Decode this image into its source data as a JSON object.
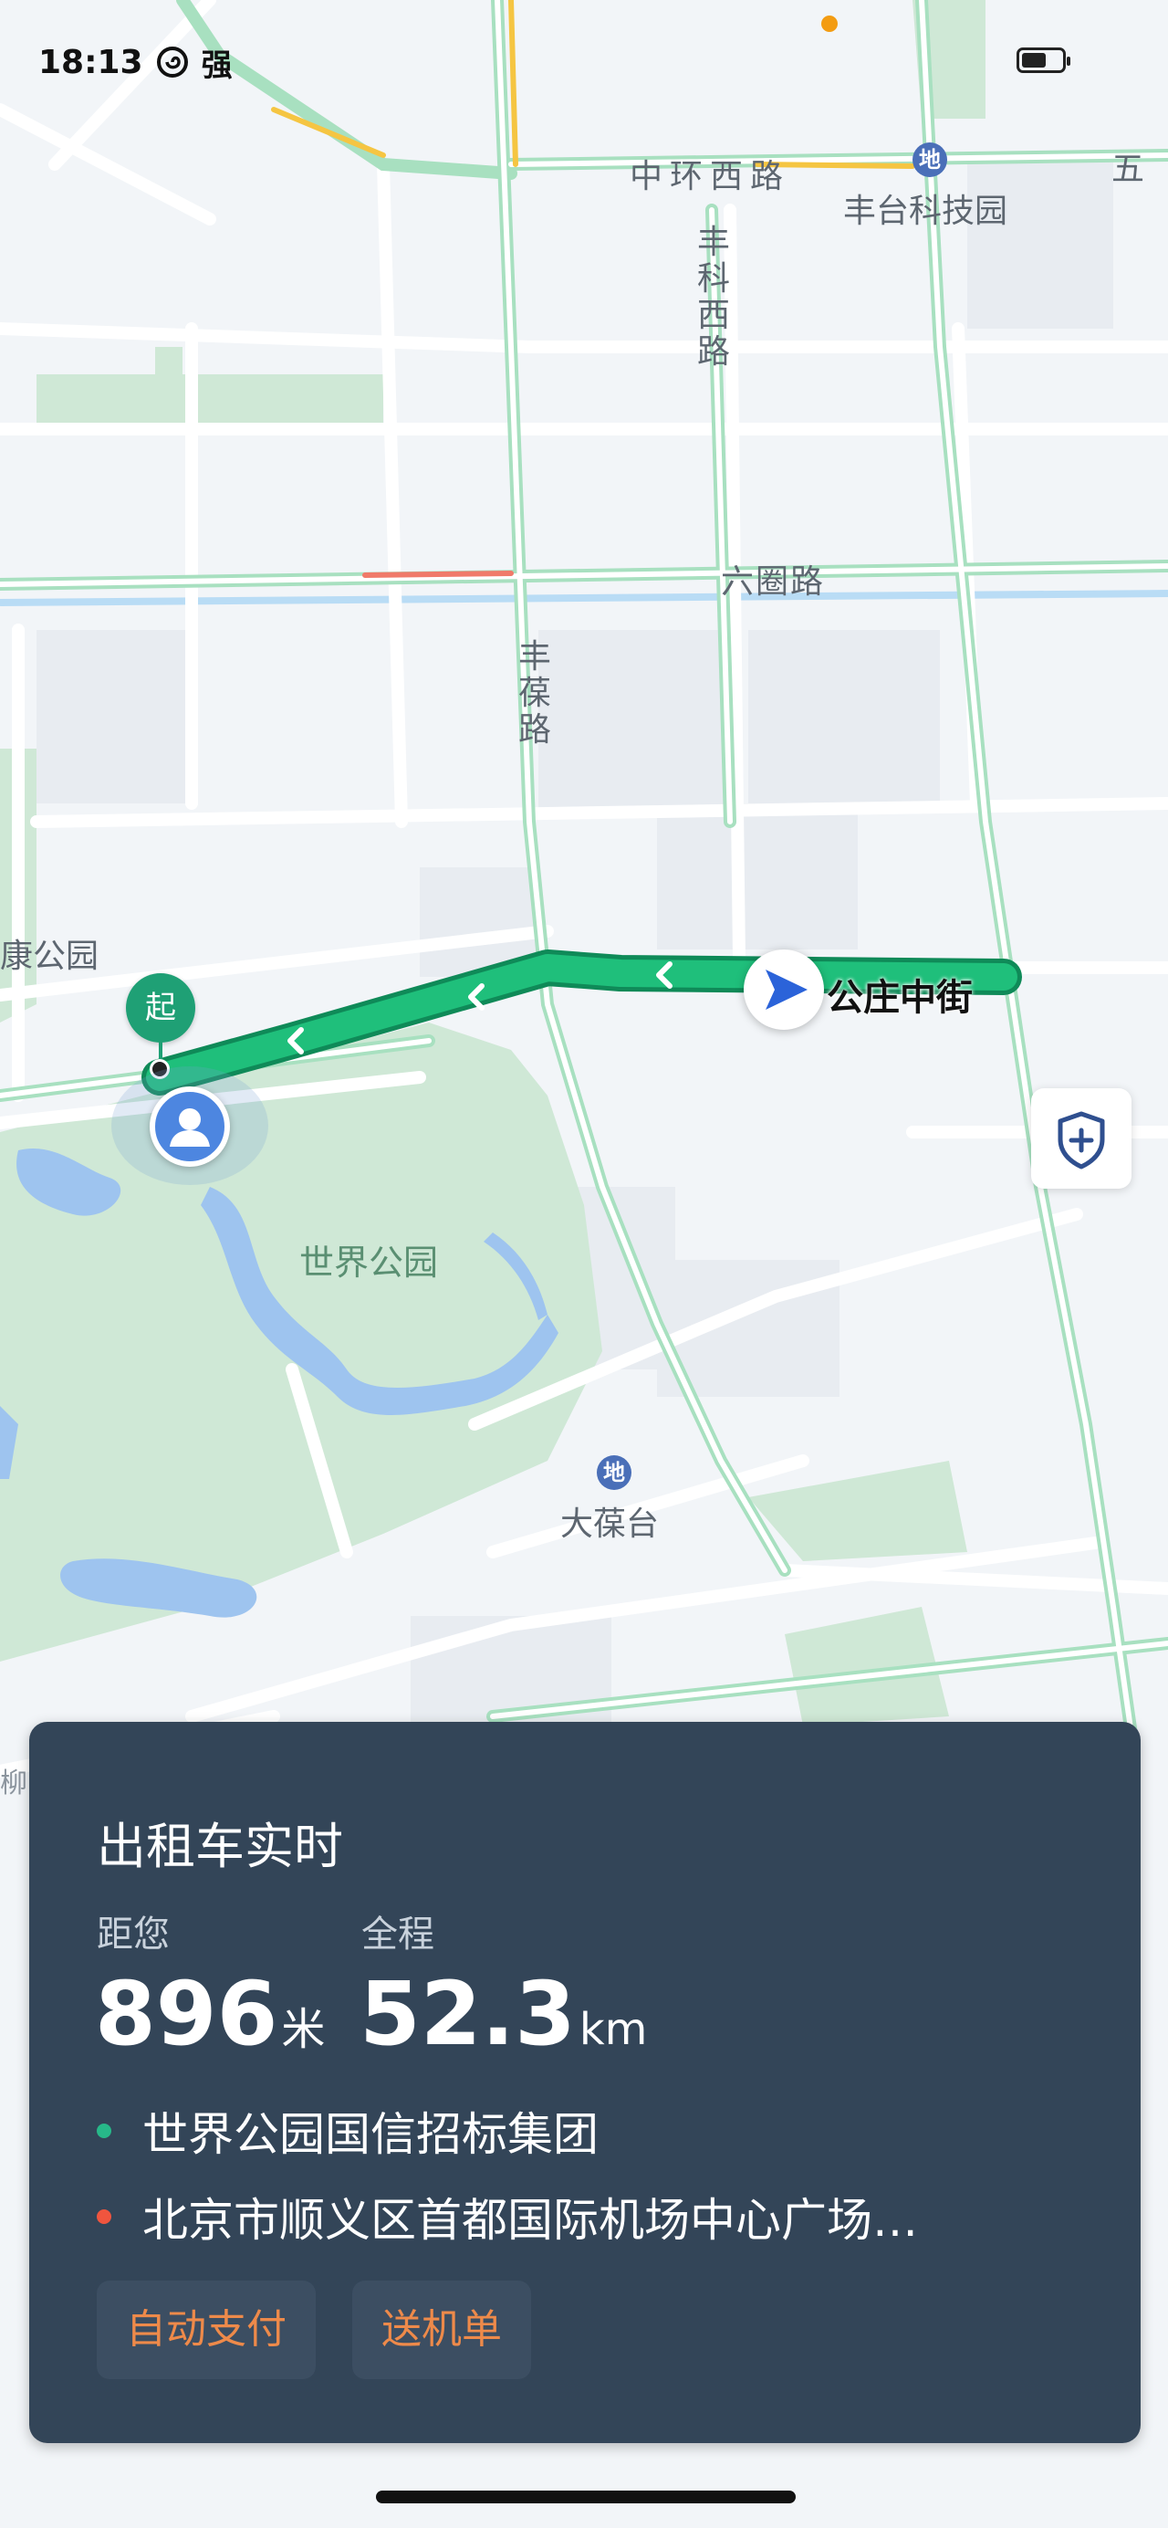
{
  "status_bar": {
    "time": "18:13",
    "network_label": "强"
  },
  "map": {
    "road_labels": {
      "zhonghuan_xilu": "中环西路",
      "wu": "五",
      "liuquan_lu": "六圈路"
    },
    "vertical_road_labels": {
      "fengke_xilu": "丰科西路",
      "fengbao_lu": "丰葆路"
    },
    "poi_labels": {
      "fengtai_keji_yuan": "丰台科技园",
      "datai": "大葆台",
      "shijie_gongyuan": "世界公园",
      "kang_gongyuan": "康公园",
      "liu": "柳"
    },
    "metro_icon_glyph": "地",
    "start_pin_label": "起",
    "taxi_location_label": "公庄中街",
    "colors": {
      "route": "#1fbf7b",
      "route_border": "#0f8a58",
      "start_pin": "#1fa075",
      "park": "#cfe8d6",
      "water": "#9ec4ef",
      "road_green": "#a8e0c0"
    }
  },
  "safety_button": {
    "icon": "shield-plus-icon"
  },
  "card": {
    "title": "出租车实时",
    "distance_label": "距您",
    "distance_value": "896",
    "distance_unit": "米",
    "total_label": "全程",
    "total_value": "52.3",
    "total_unit": "km",
    "origin": "世界公园国信招标集团",
    "destination": "北京市顺义区首都国际机场中心广场…",
    "origin_color": "#27b889",
    "destination_color": "#f0553e",
    "auto_pay_label": "自动支付",
    "airport_dropoff_label": "送机单",
    "accent_color": "#ee8a4a"
  }
}
